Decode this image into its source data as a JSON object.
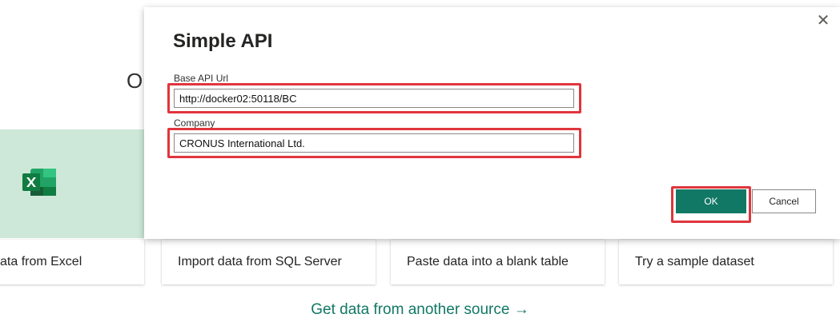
{
  "background": {
    "heading_fragment": "O",
    "cards": [
      {
        "label": "ata from Excel"
      },
      {
        "label": "Import data from SQL Server"
      },
      {
        "label": "Paste data into a blank table"
      },
      {
        "label": "Try a sample dataset"
      }
    ],
    "another_source_link": "Get data from another source →"
  },
  "dialog": {
    "title": "Simple API",
    "close_glyph": "✕",
    "fields": {
      "base_url": {
        "label": "Base API Url",
        "value": "http://docker02:50118/BC"
      },
      "company": {
        "label": "Company",
        "value": "CRONUS International Ltd."
      }
    },
    "buttons": {
      "ok": "OK",
      "cancel": "Cancel"
    }
  },
  "colors": {
    "accent": "#117865",
    "highlight": "#e0353c",
    "excel_tile": "#cde8d8"
  }
}
